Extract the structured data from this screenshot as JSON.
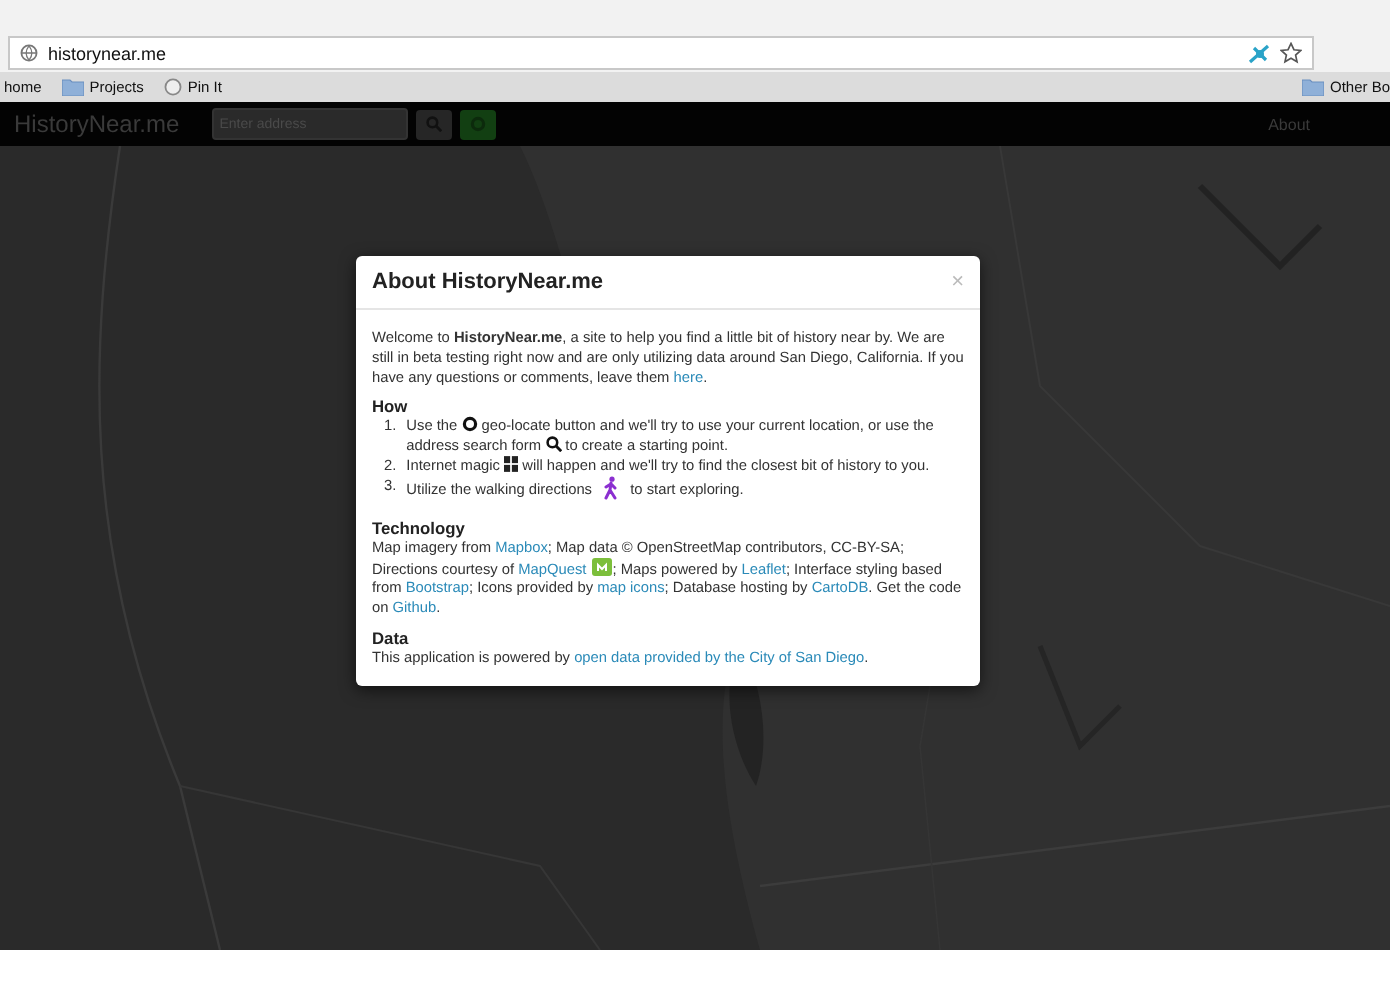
{
  "browser": {
    "url": "historynear.me",
    "bookmarks": [
      {
        "label": "home",
        "kind": "text"
      },
      {
        "label": "Projects",
        "kind": "folder"
      },
      {
        "label": "Pin It",
        "kind": "globe"
      }
    ],
    "other_bookmarks": "Other Bo"
  },
  "navbar": {
    "brand": "HistoryNear.me",
    "search": {
      "placeholder": "Enter address"
    },
    "about": "About"
  },
  "modal": {
    "title": "About HistoryNear.me",
    "close": "×",
    "intro": [
      {
        "kind": "text",
        "text": "Welcome to **HistoryNear.me**, a site to help you find a little bit of history near by. We are still in beta testing right now and are only utilizing data around San Diego, California. If you have any questions or comments, leave them "
      },
      {
        "kind": "link",
        "text": "here"
      },
      {
        "kind": "text",
        "text": "."
      }
    ],
    "how_heading": "How",
    "steps": [
      {
        "number": "1.",
        "parts": [
          {
            "kind": "text",
            "text": "Use the "
          },
          {
            "kind": "locate-icon"
          },
          {
            "kind": "text",
            "text": " geo-locate button and we'll try to use your current location, or use the address search form "
          },
          {
            "kind": "search-icon"
          },
          {
            "kind": "text",
            "text": " to create a starting point."
          }
        ]
      },
      {
        "number": "2.",
        "parts": [
          {
            "kind": "text",
            "text": "Internet magic "
          },
          {
            "kind": "grid-icon"
          },
          {
            "kind": "text",
            "text": " will happen and we'll try to find the closest bit of history to you."
          }
        ]
      },
      {
        "number": "3.",
        "parts": [
          {
            "kind": "text",
            "text": "Utilize the walking directions "
          },
          {
            "kind": "walker-icon"
          },
          {
            "kind": "text",
            "text": " to start exploring."
          }
        ]
      }
    ],
    "tech_heading": "Technology",
    "tech": [
      {
        "kind": "text",
        "text": "Map imagery from "
      },
      {
        "kind": "link",
        "text": "Mapbox"
      },
      {
        "kind": "text",
        "text": "; Map data © OpenStreetMap contributors, CC-BY-SA; Directions courtesy of "
      },
      {
        "kind": "link",
        "text": "MapQuest"
      },
      {
        "kind": "mq-icon"
      },
      {
        "kind": "text",
        "text": "; Maps powered by "
      },
      {
        "kind": "link",
        "text": "Leaflet"
      },
      {
        "kind": "text",
        "text": "; Interface styling based from "
      },
      {
        "kind": "link",
        "text": "Bootstrap"
      },
      {
        "kind": "text",
        "text": "; Icons provided by "
      },
      {
        "kind": "link",
        "text": "map icons"
      },
      {
        "kind": "text",
        "text": "; Database hosting by "
      },
      {
        "kind": "link",
        "text": "CartoDB"
      },
      {
        "kind": "text",
        "text": ". Get the code on "
      },
      {
        "kind": "link",
        "text": "Github"
      },
      {
        "kind": "text",
        "text": "."
      }
    ],
    "data_heading": "Data",
    "data": [
      {
        "kind": "text",
        "text": "This application is powered by "
      },
      {
        "kind": "link",
        "text": "open data provided by the City of San Diego"
      },
      {
        "kind": "text",
        "text": "."
      }
    ]
  }
}
